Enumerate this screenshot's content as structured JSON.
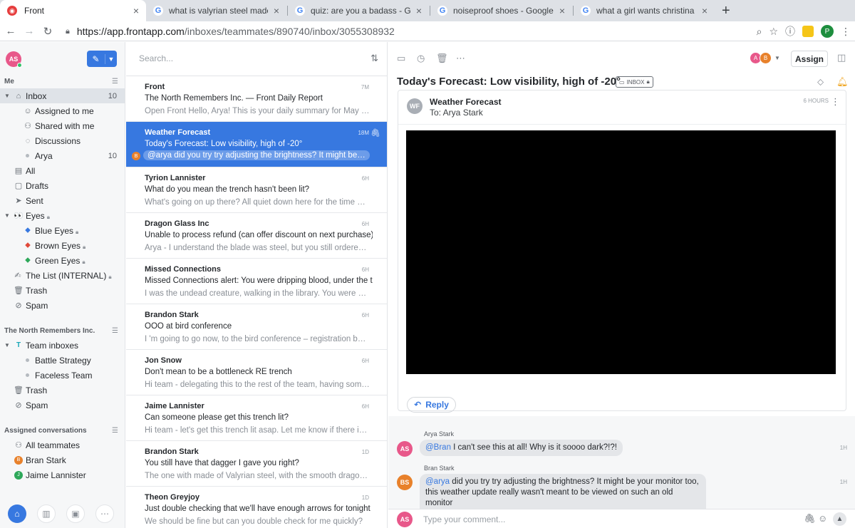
{
  "browser": {
    "tabs": [
      {
        "title": "Front",
        "favicon": "front-icon",
        "active": true
      },
      {
        "title": "what is valyrian steel made of -",
        "favicon": "google-icon"
      },
      {
        "title": "quiz: are you a badass - Googl",
        "favicon": "google-icon"
      },
      {
        "title": "noiseproof shoes - Google Sea",
        "favicon": "google-icon"
      },
      {
        "title": "what a girl wants christina agui",
        "favicon": "google-icon"
      }
    ],
    "new_tab": "+",
    "close": "×",
    "url_scheme": "https://app.frontapp.com",
    "url_path": "/inboxes/teammates/890740/inbox/3055308932",
    "profile_initial": "P"
  },
  "sidebar": {
    "user_initials": "AS",
    "me_header": "Me",
    "me_items": [
      {
        "label": "Inbox",
        "count": "10",
        "icon": "inbox-icon",
        "selected": true
      },
      {
        "label": "Assigned to me",
        "icon": "person-icon"
      },
      {
        "label": "Shared with me",
        "icon": "people-icon"
      },
      {
        "label": "Discussions",
        "icon": "chat-icon"
      },
      {
        "label": "Arya",
        "count": "10",
        "icon": "bullet-icon"
      },
      {
        "label": "All",
        "icon": "stack-icon"
      },
      {
        "label": "Drafts",
        "icon": "draft-icon"
      },
      {
        "label": "Sent",
        "icon": "send-icon"
      },
      {
        "label": "Eyes",
        "icon": "eyes-icon"
      },
      {
        "label": "Blue Eyes",
        "icon": "tag-icon",
        "tag_color": "#3778e0"
      },
      {
        "label": "Brown Eyes",
        "icon": "tag-icon",
        "tag_color": "#e0493a"
      },
      {
        "label": "Green Eyes",
        "icon": "tag-icon",
        "tag_color": "#2ea85a"
      },
      {
        "label": "The List (INTERNAL)",
        "icon": "writing-hand-icon"
      },
      {
        "label": "Trash",
        "icon": "trash-icon"
      },
      {
        "label": "Spam",
        "icon": "spam-icon"
      }
    ],
    "team_header": "The North Remembers Inc.",
    "team_items": [
      {
        "label": "Team inboxes",
        "icon": "team-icon"
      },
      {
        "label": "Battle Strategy",
        "icon": "bullet-icon"
      },
      {
        "label": "Faceless Team",
        "icon": "bullet-icon"
      },
      {
        "label": "Trash",
        "icon": "trash-icon"
      },
      {
        "label": "Spam",
        "icon": "spam-icon"
      }
    ],
    "assigned_header": "Assigned conversations",
    "assigned_items": [
      {
        "label": "All teammates",
        "icon": "people-icon"
      },
      {
        "label": "Bran Stark",
        "initial": "B",
        "color": "#e8812b"
      },
      {
        "label": "Jaime Lannister",
        "initial": "J",
        "color": "#2ea85a"
      }
    ]
  },
  "list": {
    "search_placeholder": "Search...",
    "conversations": [
      {
        "from": "Front",
        "subject": "The North Remembers Inc. — Front Daily Report",
        "preview": "Open Front Hello, Arya! This is your daily summary for May 1st...",
        "time": "7M"
      },
      {
        "from": "Weather Forecast",
        "subject": "Today's Forecast: Low visibility, high of -20°",
        "preview": "@arya did you try try adjusting the brightness? It might be your ...",
        "time": "18M",
        "selected": true,
        "avatar": "B"
      },
      {
        "from": "Tyrion Lannister",
        "subject": "What do you mean the trench hasn't been lit?",
        "preview": "What's going on up there? All quiet down here for the time bei...",
        "time": "6H"
      },
      {
        "from": "Dragon Glass Inc",
        "subject": "Unable to process refund (can offer discount on next purchase)",
        "preview": "Arya - I understand the blade was steel, but you still ordered 2...",
        "time": "6H"
      },
      {
        "from": "Missed Connections",
        "subject": "Missed Connections alert: You were dripping blood, under the tab...",
        "preview": "I was the undead creature, walking in the library. You were sile...",
        "time": "6H"
      },
      {
        "from": "Brandon Stark",
        "subject": "OOO at bird conference",
        "preview": "I 'm going to go now, to the bird conference – registration begi...",
        "time": "6H"
      },
      {
        "from": "Jon Snow",
        "subject": "Don't mean to be a bottleneck RE trench",
        "preview": "Hi team - delegating this to the rest of the team, having some ...",
        "time": "6H"
      },
      {
        "from": "Jaime Lannister",
        "subject": "Can someone please get this trench lit?",
        "preview": "Hi team - let's get this trench lit asap. Let me know if there is ...",
        "time": "6H"
      },
      {
        "from": "Brandon Stark",
        "subject": "You still have that dagger I gave you right?",
        "preview": "The one with made of Valyrian steel, with the smooth dragonb...",
        "time": "1D"
      },
      {
        "from": "Theon Greyjoy",
        "subject": "Just double checking that we'll have enough arrows for tonight",
        "preview": "We should be fine but can you double check for me quickly?",
        "time": "1D"
      }
    ]
  },
  "detail": {
    "assignee_initials": [
      "A",
      "B"
    ],
    "assign_label": "Assign",
    "title": "Today's Forecast: Low visibility, high of -20°",
    "inbox_tag": "INBOX",
    "message": {
      "avatar": "WF",
      "from": "Weather Forecast",
      "to": "To: Arya Stark",
      "time": "6 HOURS",
      "reply_label": "Reply"
    },
    "comments": [
      {
        "author": "Arya Stark",
        "initials": "AS",
        "color": "#e8588a",
        "mention": "@Bran",
        "text": " I can't see this at all! Why is it soooo dark?!?!",
        "time": "1H"
      },
      {
        "author": "Bran Stark",
        "initials": "BS",
        "color": "#e8812b",
        "mention": "@arya",
        "text": " did you try try adjusting the brightness? It might be your monitor too, this weather update really wasn't meant to be viewed on such an old monitor",
        "emoji": "🤔",
        "time": "1H"
      }
    ],
    "composer_initials": "AS",
    "composer_placeholder": "Type your comment..."
  }
}
